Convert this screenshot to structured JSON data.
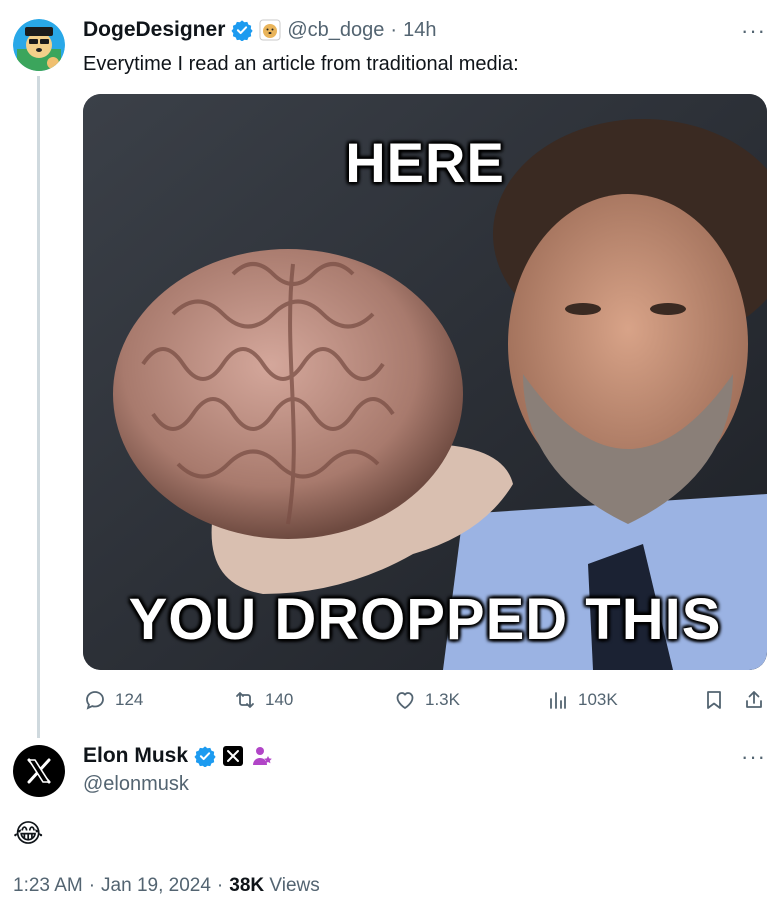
{
  "quoted_tweet": {
    "display_name": "DogeDesigner",
    "handle": "@cb_doge",
    "separator": "·",
    "time_ago": "14h",
    "text": "Everytime I read an article from traditional media:",
    "more": "···",
    "media": {
      "top_caption": "HERE",
      "bottom_caption": "YOU DROPPED THIS"
    },
    "actions": {
      "replies": "124",
      "reposts": "140",
      "likes": "1.3K",
      "views": "103K"
    }
  },
  "reply_tweet": {
    "display_name": "Elon Musk",
    "handle": "@elonmusk",
    "more": "···",
    "text": "😂",
    "time": "1:23 AM",
    "date_sep": "·",
    "date": "Jan 19, 2024",
    "views_sep": "·",
    "views_count": "38K",
    "views_label": "Views"
  },
  "colors": {
    "verified": "#1d9bf0",
    "text": "#0f1419",
    "muted": "#536471",
    "thread_line": "#cfd9de"
  }
}
